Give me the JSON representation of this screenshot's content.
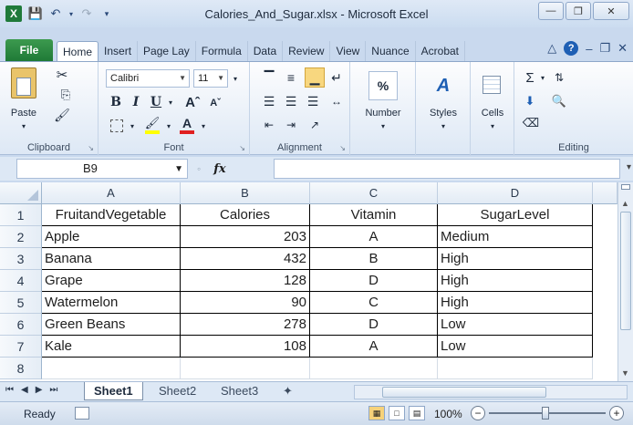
{
  "window": {
    "title": "Calories_And_Sugar.xlsx - Microsoft Excel",
    "app_logo": "X",
    "controls": {
      "minimize": "—",
      "restore": "❐",
      "close": "✕"
    }
  },
  "ribbon": {
    "file_tab": "File",
    "tabs": [
      "Home",
      "Insert",
      "Page Lay",
      "Formula",
      "Data",
      "Review",
      "View",
      "Nuance",
      "Acrobat"
    ],
    "active_tab": "Home",
    "groups": {
      "clipboard": {
        "label": "Clipboard",
        "paste": "Paste"
      },
      "font": {
        "label": "Font",
        "font_name": "Calibri",
        "font_size": "11",
        "bold": "B",
        "italic": "I",
        "underline": "U"
      },
      "alignment": {
        "label": "Alignment"
      },
      "number": {
        "label": "Number",
        "button": "Number",
        "icon": "%"
      },
      "styles": {
        "label": "Styles",
        "button": "Styles"
      },
      "cells": {
        "label": "Cells",
        "button": "Cells"
      },
      "editing": {
        "label": "Editing",
        "sigma": "Σ"
      }
    }
  },
  "formula_bar": {
    "name_box": "B9",
    "fx_label": "fx",
    "formula": ""
  },
  "sheet": {
    "columns": [
      "A",
      "B",
      "C",
      "D"
    ],
    "row_numbers": [
      "1",
      "2",
      "3",
      "4",
      "5",
      "6",
      "7",
      "8"
    ],
    "header": [
      "FruitandVegetable",
      "Calories",
      "Vitamin",
      "SugarLevel"
    ],
    "rows": [
      [
        "Apple",
        "203",
        "A",
        "Medium"
      ],
      [
        "Banana",
        "432",
        "B",
        "High"
      ],
      [
        "Grape",
        "128",
        "D",
        "High"
      ],
      [
        "Watermelon",
        "90",
        "C",
        "High"
      ],
      [
        "Green Beans",
        "278",
        "D",
        "Low"
      ],
      [
        "Kale",
        "108",
        "A",
        "Low"
      ]
    ]
  },
  "sheet_tabs": [
    "Sheet1",
    "Sheet2",
    "Sheet3"
  ],
  "active_sheet": "Sheet1",
  "status": {
    "mode": "Ready",
    "zoom": "100%"
  },
  "colors": {
    "file_tab": "#1f7a36",
    "ribbon_bg": "#dde8f5",
    "active_view": "#f6d27a"
  }
}
